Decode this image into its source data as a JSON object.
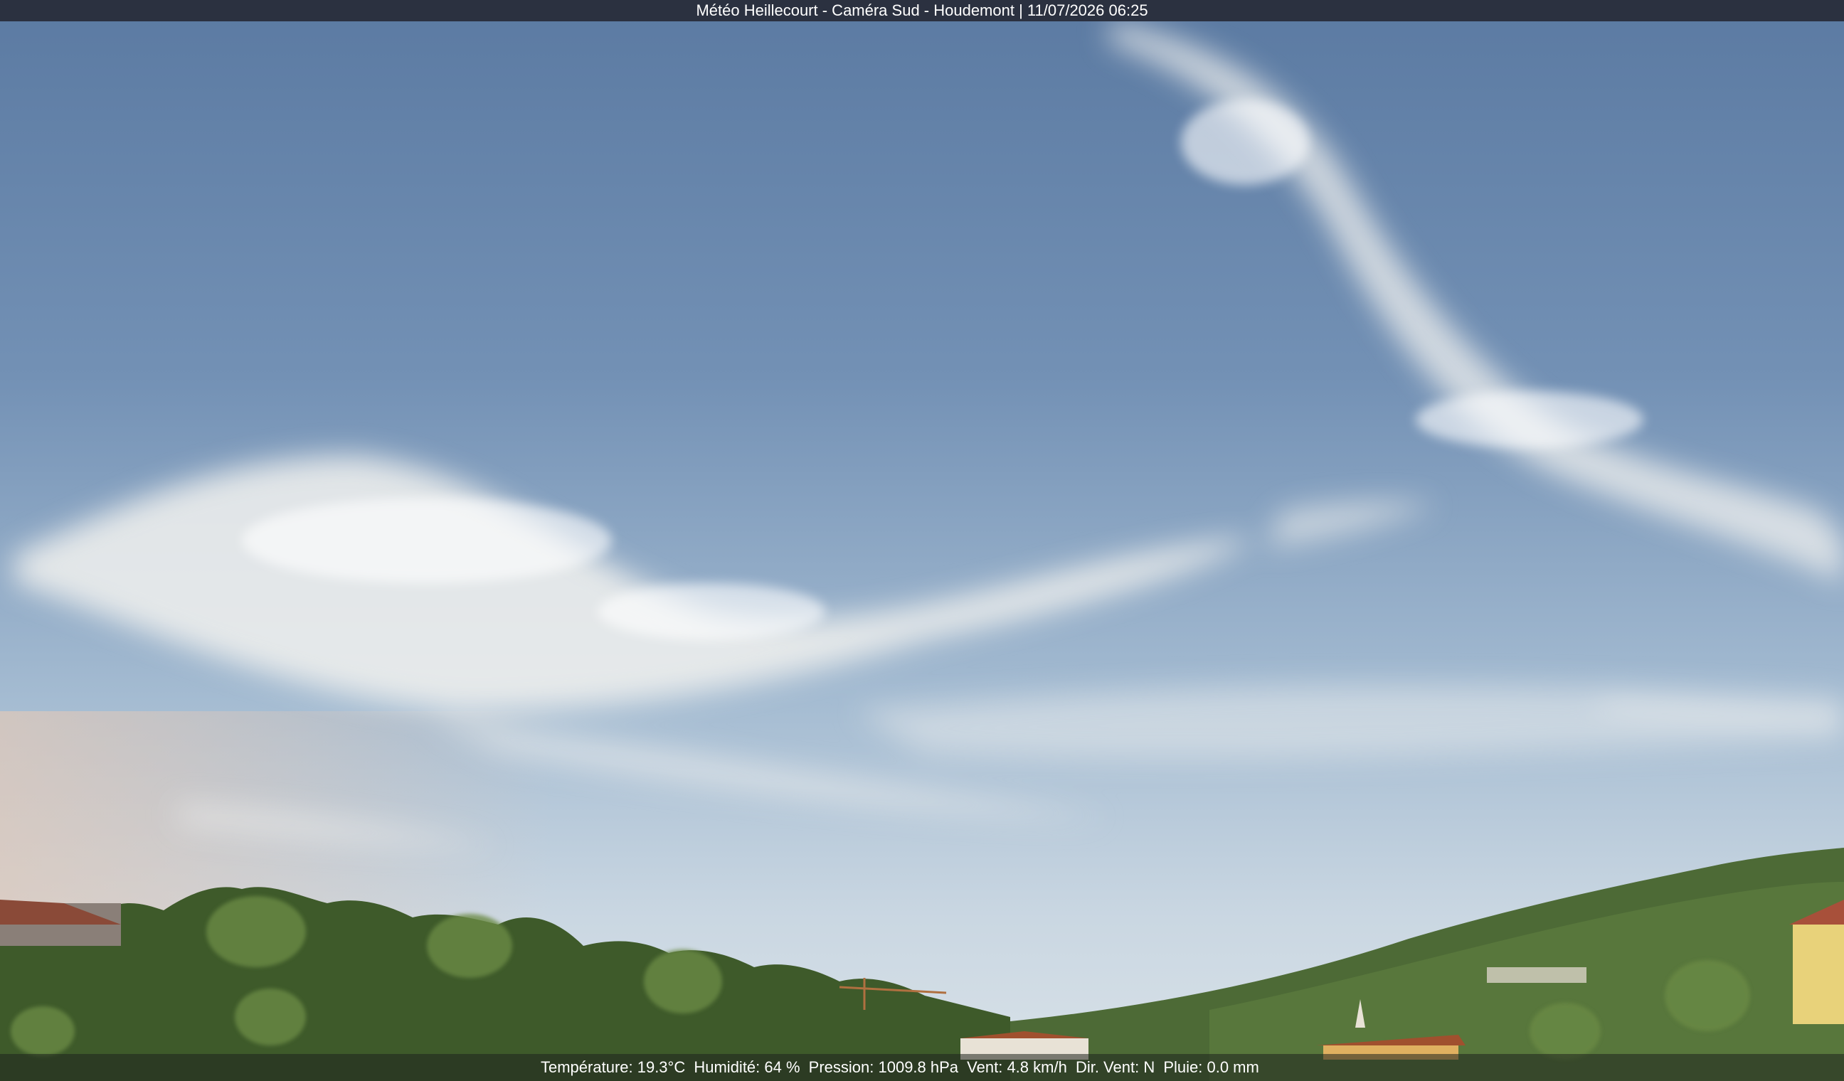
{
  "title": "Météo Heillecourt - Caméra Sud - Houdemont | 11/07/2026 06:25",
  "weather": {
    "temperature": "Température: 19.3°C",
    "humidity": "Humidité: 64 %",
    "pressure": "Pression: 1009.8 hPa",
    "wind": "Vent: 4.8 km/h",
    "wind_dir": "Dir. Vent: N",
    "rain": "Pluie: 0.0 mm"
  },
  "colors": {
    "sky_top": "#5f7ea6",
    "sky_horizon": "#c9d6e2",
    "cloud": "#f2f2f0",
    "foliage": "#3e5a2a",
    "roof": "#a0502e"
  }
}
